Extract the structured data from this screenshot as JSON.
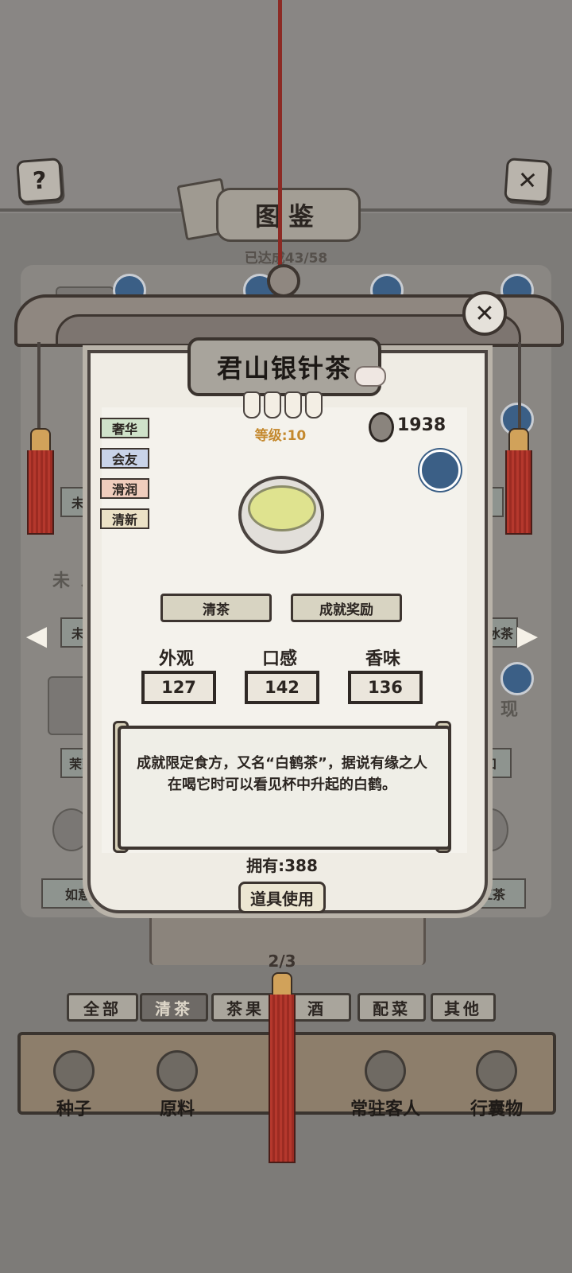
{
  "background": {
    "title": "图鉴",
    "progress": "已达成43/58",
    "help_glyph": "?",
    "close_glyph": "✕",
    "undiscovered_text": "未发现",
    "card_labels": [
      "未",
      "知",
      "茉莉",
      "知",
      "如意茶",
      "福香红茶",
      "未",
      "冰茶"
    ],
    "page_indicator": "2/3",
    "tabs": [
      "全部",
      "清茶",
      "茶果",
      "酒",
      "配菜",
      "其他"
    ],
    "bottom_nav": [
      "种子",
      "原料",
      "",
      "常驻客人",
      "行囊物"
    ]
  },
  "detail": {
    "title": "君山银针茶",
    "close_glyph": "✕",
    "level": "等级:10",
    "star_count": 4,
    "price": "1938",
    "tags": [
      {
        "label": "奢华",
        "color": "#cfe2c9"
      },
      {
        "label": "会友",
        "color": "#c9d3e8"
      },
      {
        "label": "滑润",
        "color": "#f0cdbd"
      },
      {
        "label": "清新",
        "color": "#ece2c6"
      }
    ],
    "category_button": "清茶",
    "achievement_button": "成就奖励",
    "stats": [
      {
        "label": "外观",
        "value": "127"
      },
      {
        "label": "口感",
        "value": "142"
      },
      {
        "label": "香味",
        "value": "136"
      }
    ],
    "description": "成就限定食方，又名“白鹤茶”，据说有缘之人在喝它时可以看见杯中升起的白鹤。",
    "owned": "拥有:388",
    "use_button": "道具使用",
    "arrows": {
      "left": "◀",
      "right": "▶"
    }
  }
}
